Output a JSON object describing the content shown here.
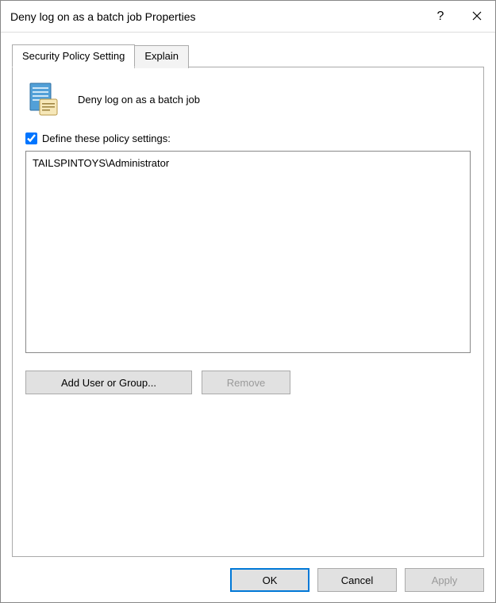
{
  "window": {
    "title": "Deny log on as a batch job Properties"
  },
  "tabs": [
    {
      "label": "Security Policy Setting",
      "active": true
    },
    {
      "label": "Explain",
      "active": false
    }
  ],
  "policy": {
    "name": "Deny log on as a batch job",
    "checkbox_label": "Define these policy settings:",
    "checked": true,
    "entries": [
      "TAILSPINTOYS\\Administrator"
    ]
  },
  "buttons": {
    "add": "Add User or Group...",
    "remove": "Remove",
    "ok": "OK",
    "cancel": "Cancel",
    "apply": "Apply"
  }
}
